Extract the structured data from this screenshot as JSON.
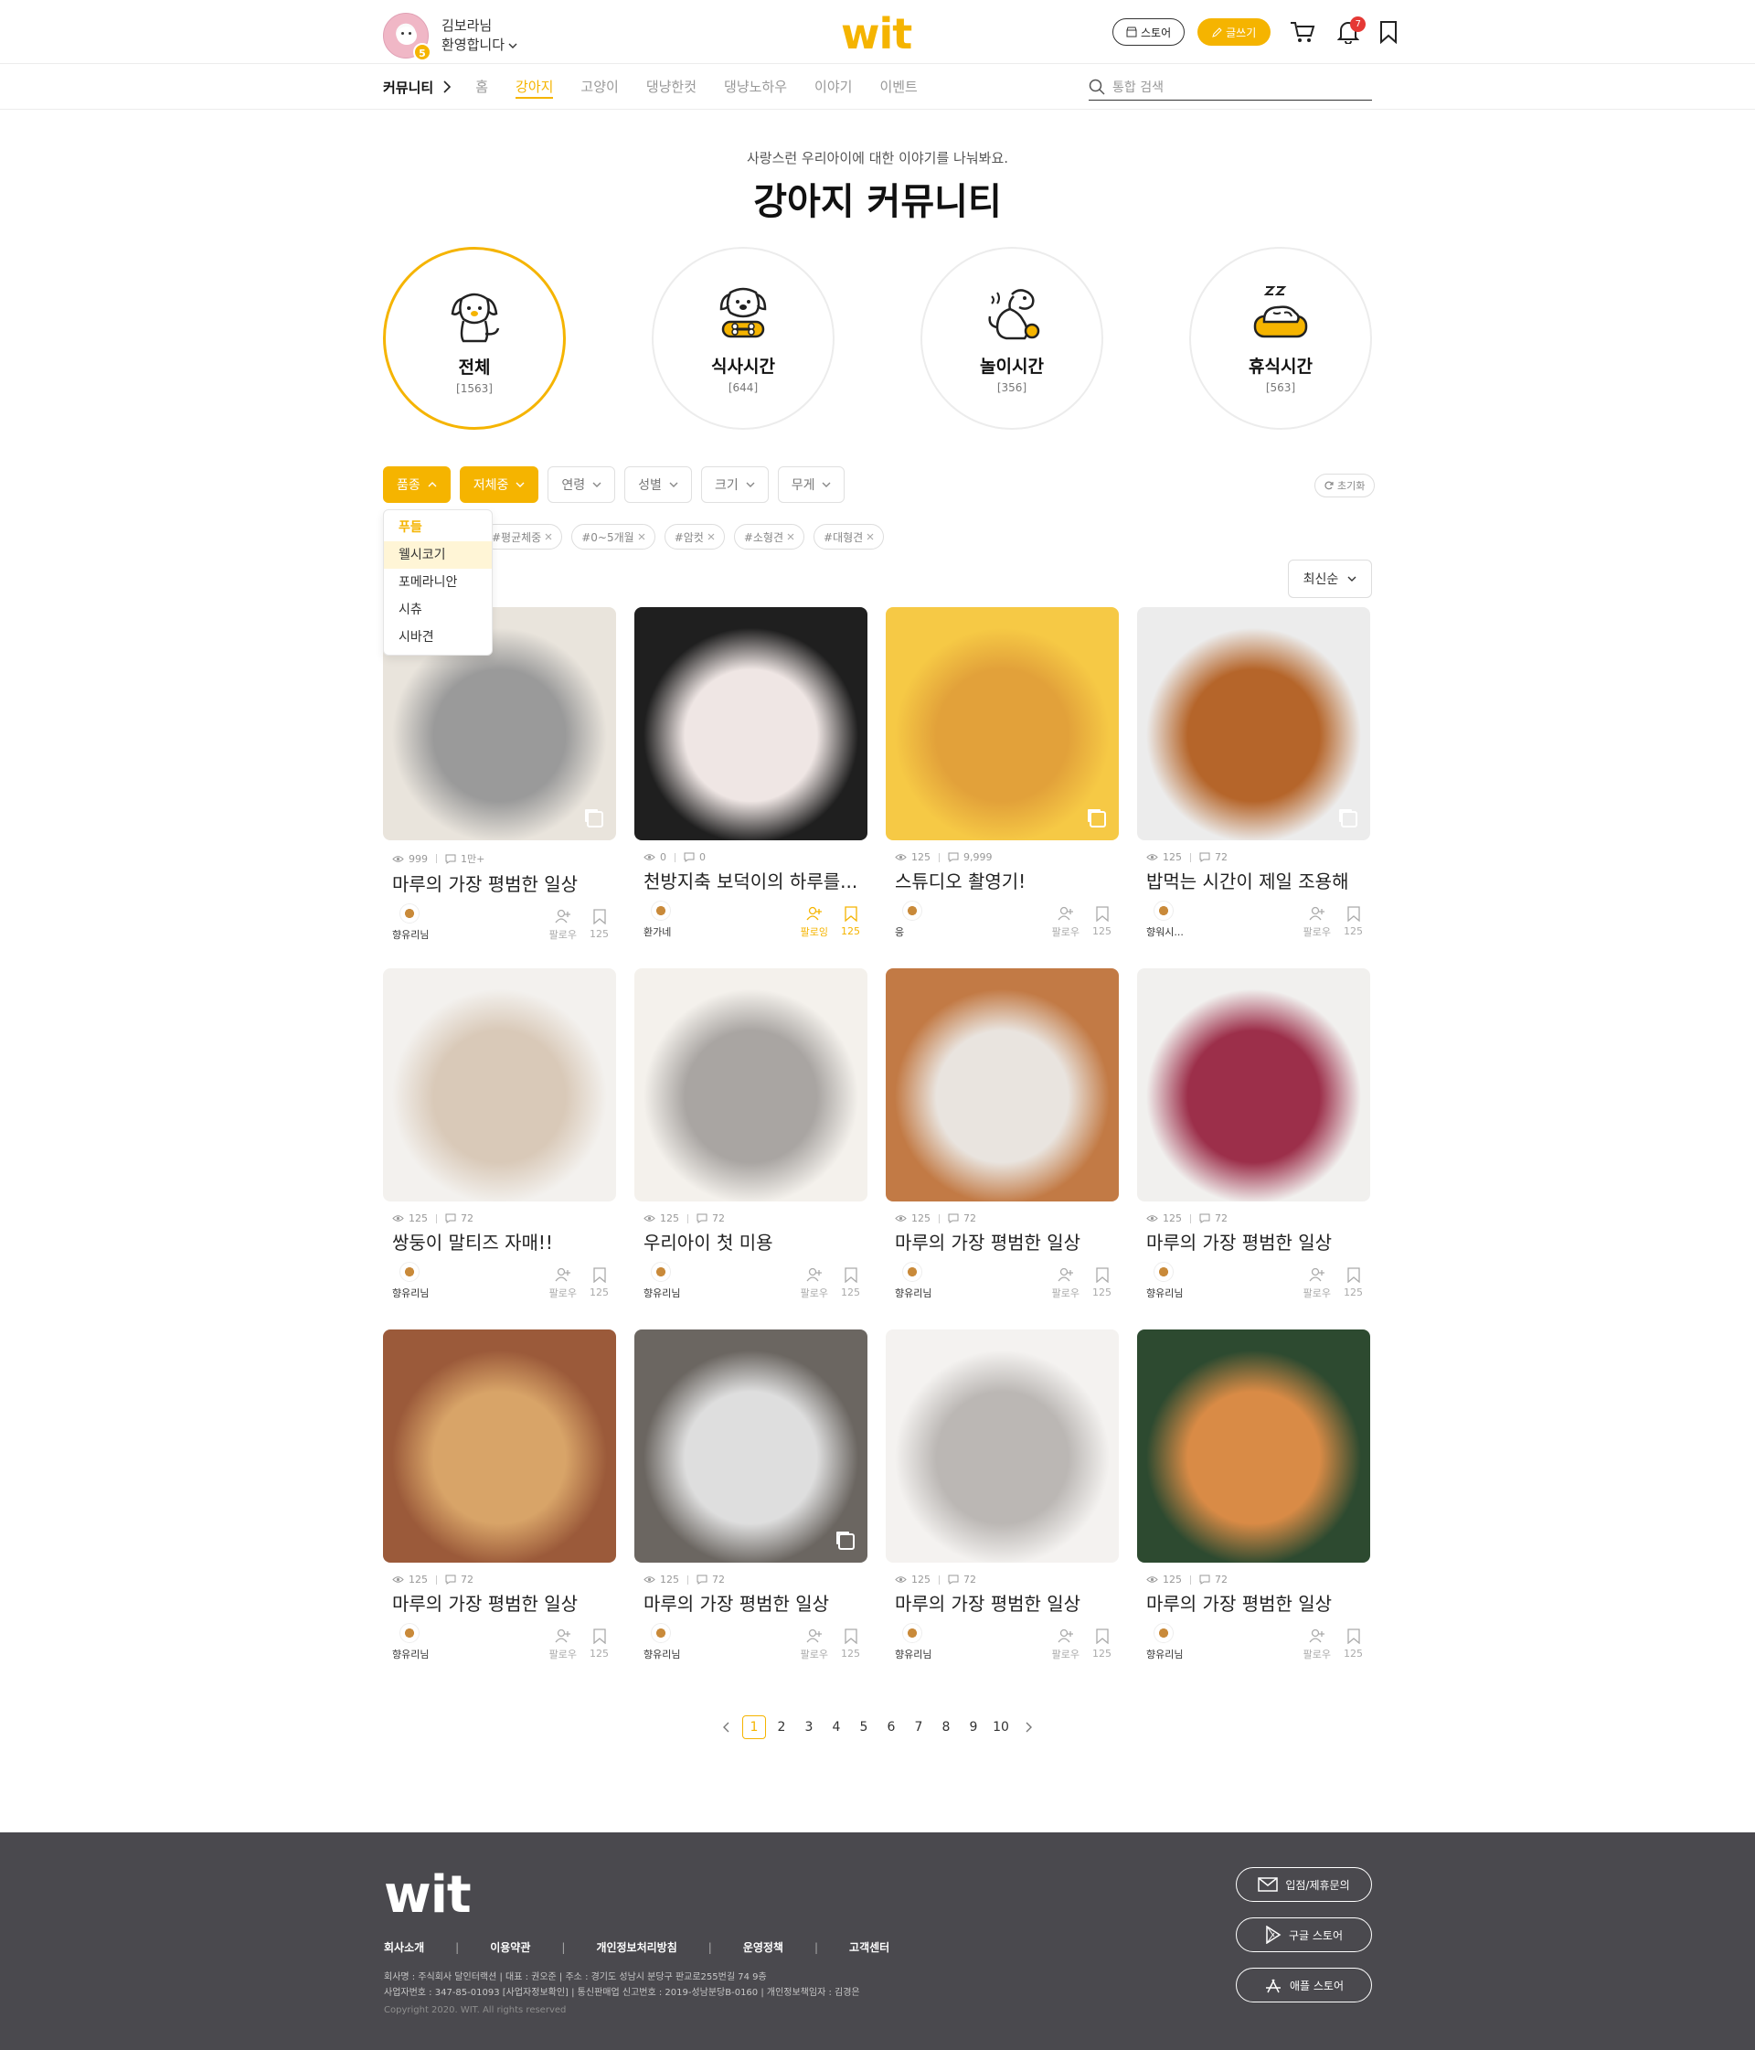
{
  "header": {
    "user_name": "김보라님",
    "greeting": "환영합니다",
    "level": "5",
    "logo": "wit",
    "store_label": "스토어",
    "write_label": "글쓰기",
    "notification_count": "7",
    "icons": [
      "store-icon",
      "pencil-icon",
      "cart-icon",
      "bell-icon",
      "bookmark-icon"
    ]
  },
  "nav": {
    "title": "커뮤니티",
    "items": [
      "홈",
      "강아지",
      "고양이",
      "댕냥한컷",
      "댕냥노하우",
      "이야기",
      "이벤트"
    ],
    "active": "강아지",
    "search_placeholder": "통합 검색"
  },
  "hero": {
    "subtitle": "사랑스런 우리아이에 대한 이야기를 나눠봐요.",
    "title": "강아지 커뮤니티"
  },
  "categories": [
    {
      "name": "전체",
      "count": "[1563]",
      "icon": "dog-sitting-icon",
      "active": true
    },
    {
      "name": "식사시간",
      "count": "[644]",
      "icon": "dog-bone-icon",
      "active": false
    },
    {
      "name": "놀이시간",
      "count": "[356]",
      "icon": "dog-ball-icon",
      "active": false
    },
    {
      "name": "휴식시간",
      "count": "[563]",
      "icon": "dog-sleep-icon",
      "active": false
    }
  ],
  "filters": {
    "buttons": [
      "품종",
      "저체중",
      "연령",
      "성별",
      "크기",
      "무게"
    ],
    "reset_label": "초기화",
    "tags": [
      "#평균체중",
      "#0~5개월",
      "#암컷",
      "#소형견",
      "#대형견"
    ],
    "breed_options": [
      "푸들",
      "웰시코기",
      "포메라니안",
      "시츄",
      "시바견"
    ],
    "sort_label": "최신순"
  },
  "accent_color": "#f5b400",
  "posts": [
    {
      "title": "마루의 가장 평범한 일상",
      "views": "999",
      "comments": "1만+",
      "author": "향유리님",
      "follow": "팔로우",
      "saves": "125",
      "multi": true,
      "followed": false
    },
    {
      "title": "천방지축 보덕이의 하루를...",
      "views": "0",
      "comments": "0",
      "author": "환가네",
      "follow": "팔로잉",
      "saves": "125",
      "multi": false,
      "followed": true
    },
    {
      "title": "스튜디오 촬영기!",
      "views": "125",
      "comments": "9,999",
      "author": "응",
      "follow": "팔로우",
      "saves": "125",
      "multi": true,
      "followed": false
    },
    {
      "title": "밥먹는 시간이 제일 조용해",
      "views": "125",
      "comments": "72",
      "author": "향워시...",
      "follow": "팔로우",
      "saves": "125",
      "multi": true,
      "followed": false
    },
    {
      "title": "쌍둥이 말티즈 자매!!",
      "views": "125",
      "comments": "72",
      "author": "향유리님",
      "follow": "팔로우",
      "saves": "125",
      "multi": false,
      "followed": false
    },
    {
      "title": "우리아이 첫 미용",
      "views": "125",
      "comments": "72",
      "author": "향유리님",
      "follow": "팔로우",
      "saves": "125",
      "multi": false,
      "followed": false
    },
    {
      "title": "마루의 가장 평범한 일상",
      "views": "125",
      "comments": "72",
      "author": "향유리님",
      "follow": "팔로우",
      "saves": "125",
      "multi": false,
      "followed": false
    },
    {
      "title": "마루의 가장 평범한 일상",
      "views": "125",
      "comments": "72",
      "author": "향유리님",
      "follow": "팔로우",
      "saves": "125",
      "multi": false,
      "followed": false
    },
    {
      "title": "마루의 가장 평범한 일상",
      "views": "125",
      "comments": "72",
      "author": "향유리님",
      "follow": "팔로우",
      "saves": "125",
      "multi": false,
      "followed": false
    },
    {
      "title": "마루의 가장 평범한 일상",
      "views": "125",
      "comments": "72",
      "author": "향유리님",
      "follow": "팔로우",
      "saves": "125",
      "multi": true,
      "followed": false
    },
    {
      "title": "마루의 가장 평범한 일상",
      "views": "125",
      "comments": "72",
      "author": "향유리님",
      "follow": "팔로우",
      "saves": "125",
      "multi": false,
      "followed": false
    },
    {
      "title": "마루의 가장 평범한 일상",
      "views": "125",
      "comments": "72",
      "author": "향유리님",
      "follow": "팔로우",
      "saves": "125",
      "multi": false,
      "followed": false
    }
  ],
  "photo_colors": [
    [
      "#e9e4dc",
      "#9a9a9a"
    ],
    [
      "#1f1f1f",
      "#efe6e4"
    ],
    [
      "#f6c945",
      "#e2a13a"
    ],
    [
      "#ececec",
      "#b5652a"
    ],
    [
      "#f3f1ee",
      "#d9c9b8"
    ],
    [
      "#f4f1ec",
      "#a9a5a2"
    ],
    [
      "#c27a45",
      "#e9e4df"
    ],
    [
      "#f1f0ee",
      "#9c2f4a"
    ],
    [
      "#9b5a3a",
      "#d8a468"
    ],
    [
      "#6b6661",
      "#dedede"
    ],
    [
      "#f4f2f0",
      "#bbb7b4"
    ],
    [
      "#2d4a30",
      "#d98b46"
    ]
  ],
  "pagination": {
    "pages": [
      "1",
      "2",
      "3",
      "4",
      "5",
      "6",
      "7",
      "8",
      "9",
      "10"
    ],
    "current": "1"
  },
  "footer": {
    "logo": "wit",
    "links": [
      "회사소개",
      "이용약관",
      "개인정보처리방침",
      "운영정책",
      "고객센터"
    ],
    "info_line1": "회사명 : 주식회사 달인터랙션  |  대표 : 권오준  |  주소 : 경기도 성남시 분당구 판교로255번길 74 9층",
    "info_line2": "사업자번호 : 347-85-01093 [사업자정보확인]  |  통신판매업 신고번호 : 2019-성남분당B-0160  |  개인정보책임자 : 김경은",
    "copyright": "Copyright 2020. WIT. All rights reserved",
    "buttons": [
      {
        "label": "입점/제휴문의",
        "icon": "mail-icon"
      },
      {
        "label": "구글 스토어",
        "icon": "play-icon"
      },
      {
        "label": "애플 스토어",
        "icon": "appstore-icon"
      }
    ]
  }
}
